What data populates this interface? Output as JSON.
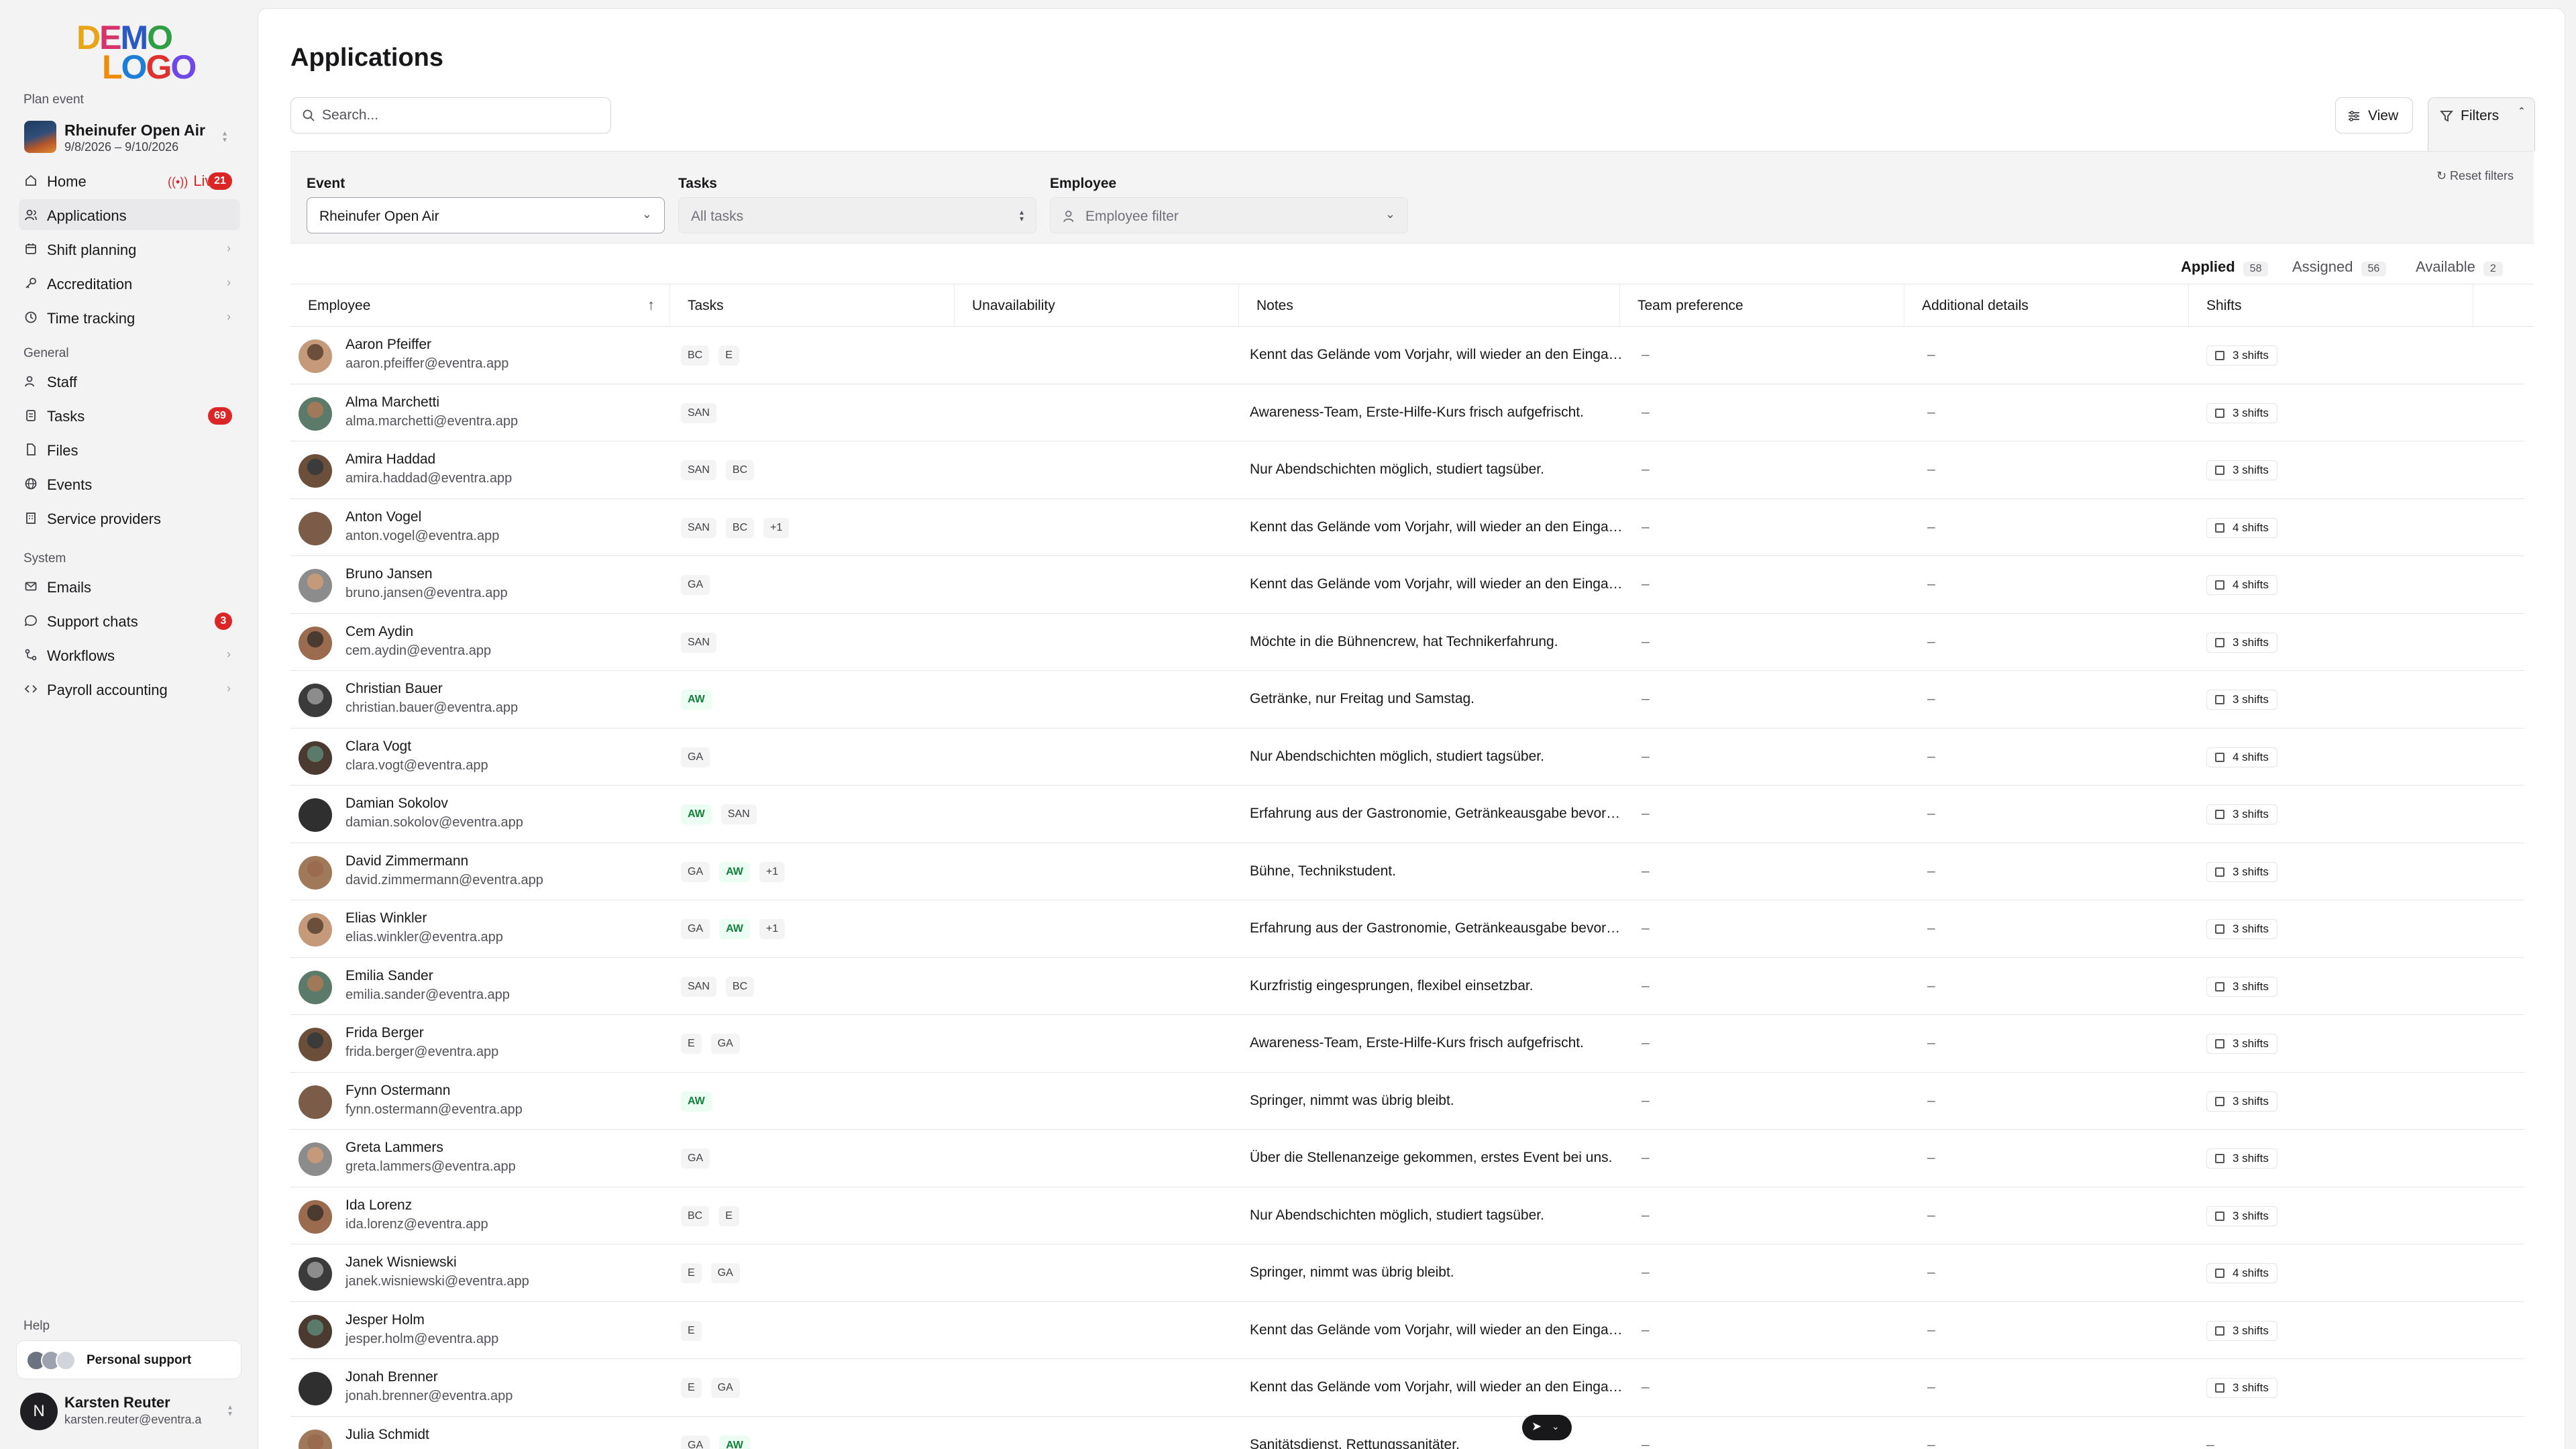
{
  "logo": {
    "line1": "DEMO",
    "line2": "LOGO"
  },
  "sidebar": {
    "plan_event_label": "Plan event",
    "event": {
      "name": "Rheinufer Open Air",
      "dates": "9/8/2026 – 9/10/2026"
    },
    "primary_items": [
      {
        "label": "Home",
        "icon": "home-icon",
        "live_label": "Live",
        "badge": "21"
      },
      {
        "label": "Applications",
        "icon": "users-icon"
      },
      {
        "label": "Shift planning",
        "icon": "calendar-icon"
      },
      {
        "label": "Accreditation",
        "icon": "key-icon"
      },
      {
        "label": "Time tracking",
        "icon": "clock-icon"
      }
    ],
    "general_label": "General",
    "general_items": [
      {
        "label": "Staff",
        "icon": "users-icon"
      },
      {
        "label": "Tasks",
        "icon": "clipboard-icon",
        "badge": "69"
      },
      {
        "label": "Files",
        "icon": "file-icon"
      },
      {
        "label": "Events",
        "icon": "globe-icon"
      },
      {
        "label": "Service providers",
        "icon": "building-icon"
      }
    ],
    "system_label": "System",
    "system_items": [
      {
        "label": "Emails",
        "icon": "mail-icon"
      },
      {
        "label": "Support chats",
        "icon": "chat-icon",
        "badge": "3"
      },
      {
        "label": "Workflows",
        "icon": "workflow-icon"
      },
      {
        "label": "Payroll accounting",
        "icon": "code-icon"
      }
    ],
    "help_label": "Help",
    "support_label": "Personal support",
    "user": {
      "initial": "N",
      "name": "Karsten Reuter",
      "email": "karsten.reuter@eventra.a"
    }
  },
  "main": {
    "title": "Applications",
    "search_placeholder": "Search...",
    "view_label": "View",
    "filters_label": "Filters",
    "reset_filters": "Reset filters",
    "filters": {
      "event_label": "Event",
      "event_value": "Rheinufer Open Air",
      "tasks_label": "Tasks",
      "tasks_value": "All tasks",
      "employee_label": "Employee",
      "employee_value": "Employee filter"
    },
    "tabs": [
      {
        "label": "Applied",
        "count": "58"
      },
      {
        "label": "Assigned",
        "count": "56"
      },
      {
        "label": "Available",
        "count": "2"
      }
    ],
    "columns": [
      "Employee",
      "Tasks",
      "Unavailability",
      "Notes",
      "Team preference",
      "Additional details",
      "Shifts"
    ],
    "dash": "–",
    "rows": [
      {
        "name": "Aaron Pfeiffer",
        "email": "aaron.pfeiffer@eventra.app",
        "tasks": [
          "BC",
          "E"
        ],
        "note": "Kennt das Gelände vom Vorjahr, will wieder an den Eingang.",
        "shifts": "3 shifts"
      },
      {
        "name": "Alma Marchetti",
        "email": "alma.marchetti@eventra.app",
        "tasks": [
          "SAN"
        ],
        "note": "Awareness-Team, Erste-Hilfe-Kurs frisch aufgefrischt.",
        "shifts": "3 shifts"
      },
      {
        "name": "Amira Haddad",
        "email": "amira.haddad@eventra.app",
        "tasks": [
          "SAN",
          "BC"
        ],
        "note": "Nur Abendschichten möglich, studiert tagsüber.",
        "shifts": "3 shifts"
      },
      {
        "name": "Anton Vogel",
        "email": "anton.vogel@eventra.app",
        "tasks": [
          "SAN",
          "BC",
          "+1"
        ],
        "note": "Kennt das Gelände vom Vorjahr, will wieder an den Eingang.",
        "shifts": "4 shifts"
      },
      {
        "name": "Bruno Jansen",
        "email": "bruno.jansen@eventra.app",
        "tasks": [
          "GA"
        ],
        "note": "Kennt das Gelände vom Vorjahr, will wieder an den Eingang.",
        "shifts": "4 shifts"
      },
      {
        "name": "Cem Aydin",
        "email": "cem.aydin@eventra.app",
        "tasks": [
          "SAN"
        ],
        "note": "Möchte in die Bühnencrew, hat Technikerfahrung.",
        "shifts": "3 shifts"
      },
      {
        "name": "Christian Bauer",
        "email": "christian.bauer@eventra.app",
        "tasks": [
          "AW"
        ],
        "note": "Getränke, nur Freitag und Samstag.",
        "shifts": "3 shifts"
      },
      {
        "name": "Clara Vogt",
        "email": "clara.vogt@eventra.app",
        "tasks": [
          "GA"
        ],
        "note": "Nur Abendschichten möglich, studiert tagsüber.",
        "shifts": "4 shifts"
      },
      {
        "name": "Damian Sokolov",
        "email": "damian.sokolov@eventra.app",
        "tasks": [
          "AW",
          "SAN"
        ],
        "note": "Erfahrung aus der Gastronomie, Getränkeausgabe bevorzugt.",
        "shifts": "3 shifts"
      },
      {
        "name": "David Zimmermann",
        "email": "david.zimmermann@eventra.app",
        "tasks": [
          "GA",
          "AW",
          "+1"
        ],
        "note": "Bühne, Technikstudent.",
        "shifts": "3 shifts"
      },
      {
        "name": "Elias Winkler",
        "email": "elias.winkler@eventra.app",
        "tasks": [
          "GA",
          "AW",
          "+1"
        ],
        "note": "Erfahrung aus der Gastronomie, Getränkeausgabe bevorzugt.",
        "shifts": "3 shifts"
      },
      {
        "name": "Emilia Sander",
        "email": "emilia.sander@eventra.app",
        "tasks": [
          "SAN",
          "BC"
        ],
        "note": "Kurzfristig eingesprungen, flexibel einsetzbar.",
        "shifts": "3 shifts"
      },
      {
        "name": "Frida Berger",
        "email": "frida.berger@eventra.app",
        "tasks": [
          "E",
          "GA"
        ],
        "note": "Awareness-Team, Erste-Hilfe-Kurs frisch aufgefrischt.",
        "shifts": "3 shifts"
      },
      {
        "name": "Fynn Ostermann",
        "email": "fynn.ostermann@eventra.app",
        "tasks": [
          "AW"
        ],
        "note": "Springer, nimmt was übrig bleibt.",
        "shifts": "3 shifts"
      },
      {
        "name": "Greta Lammers",
        "email": "greta.lammers@eventra.app",
        "tasks": [
          "GA"
        ],
        "note": "Über die Stellenanzeige gekommen, erstes Event bei uns.",
        "shifts": "3 shifts"
      },
      {
        "name": "Ida Lorenz",
        "email": "ida.lorenz@eventra.app",
        "tasks": [
          "BC",
          "E"
        ],
        "note": "Nur Abendschichten möglich, studiert tagsüber.",
        "shifts": "3 shifts"
      },
      {
        "name": "Janek Wisniewski",
        "email": "janek.wisniewski@eventra.app",
        "tasks": [
          "E",
          "GA"
        ],
        "note": "Springer, nimmt was übrig bleibt.",
        "shifts": "4 shifts"
      },
      {
        "name": "Jesper Holm",
        "email": "jesper.holm@eventra.app",
        "tasks": [
          "E"
        ],
        "note": "Kennt das Gelände vom Vorjahr, will wieder an den Eingang.",
        "shifts": "3 shifts"
      },
      {
        "name": "Jonah Brenner",
        "email": "jonah.brenner@eventra.app",
        "tasks": [
          "E",
          "GA"
        ],
        "note": "Kennt das Gelände vom Vorjahr, will wieder an den Eingang.",
        "shifts": "3 shifts"
      },
      {
        "name": "Julia Schmidt",
        "email": "",
        "tasks": [
          "GA",
          "AW"
        ],
        "note": "Sanitätsdienst, Rettungssanitäter.",
        "shifts": "–"
      }
    ]
  },
  "colors": {
    "accent_red": "#dc2626",
    "green_chip": "#15803d",
    "text": "#18181b"
  }
}
